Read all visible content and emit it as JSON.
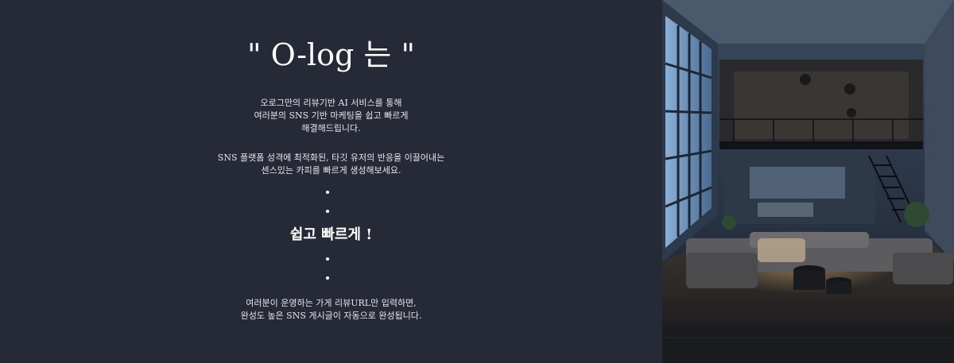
{
  "hero": {
    "title": "\" O-log 는 \"",
    "intro_lines": [
      "오로그만의 리뷰기반 AI 서비스를 통해",
      "여러분의 SNS 기반 마케팅을 쉽고 빠르게",
      "해결해드립니다."
    ],
    "platform_lines": [
      "SNS 플랫폼 성격에 최적화된, 타깃 유저의 반응을 이끌어내는",
      "센스있는 카피를 빠르게 생성해보세요."
    ],
    "highlight": "쉽고 빠르게 !",
    "outro_lines": [
      "여러분이 운영하는 가게 리뷰URL만 입력하면,",
      "완성도 높은 SNS 게시글이 자동으로 완성됩니다."
    ]
  },
  "colors": {
    "panel_bg": "#262a36",
    "text": "#ffffff"
  }
}
